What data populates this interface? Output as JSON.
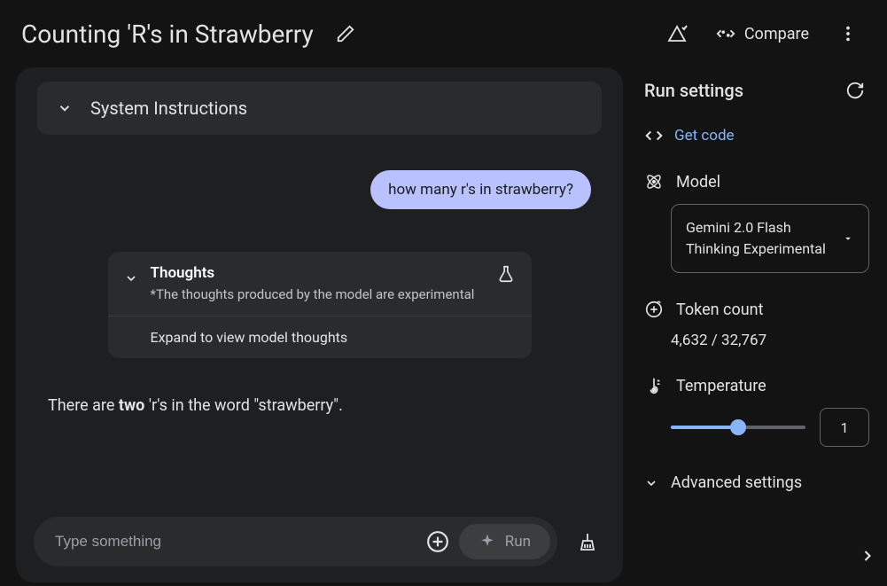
{
  "header": {
    "title": "Counting 'R's in Strawberry",
    "compare_label": "Compare"
  },
  "chat": {
    "system_instructions_label": "System Instructions",
    "user_message": "how many r's in strawberry?",
    "thoughts": {
      "title": "Thoughts",
      "subtitle": "*The thoughts produced by the model are experimental",
      "expand_label": "Expand to view model thoughts"
    },
    "response_prefix": "There are ",
    "response_bold": "two",
    "response_suffix": " 'r's in the word \"strawberry\".",
    "input_placeholder": "Type something",
    "run_label": "Run"
  },
  "settings": {
    "title": "Run settings",
    "get_code_label": "Get code",
    "model_label": "Model",
    "model_selected": "Gemini 2.0 Flash Thinking Experimental",
    "token_label": "Token count",
    "token_value": "4,632 / 32,767",
    "temperature_label": "Temperature",
    "temperature_value": "1",
    "temperature_fill_pct": "50%",
    "advanced_label": "Advanced settings"
  }
}
